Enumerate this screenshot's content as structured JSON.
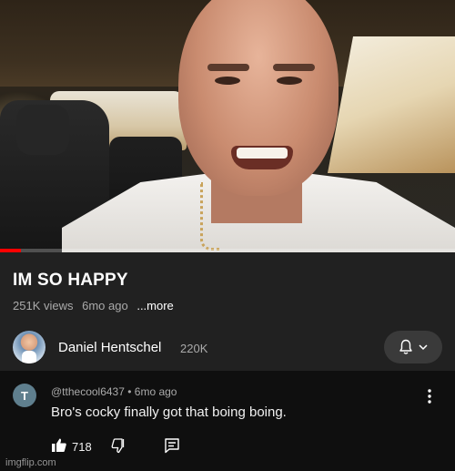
{
  "video": {
    "progress_fraction": 0.046
  },
  "meta": {
    "title": "IM SO HAPPY",
    "views": "251K views",
    "age": "6mo ago",
    "more_label": "...more"
  },
  "channel": {
    "name": "Daniel Hentschel",
    "subscribers": "220K",
    "bell_icon": "bell-icon",
    "chevron_icon": "chevron-down-icon"
  },
  "comment": {
    "avatar_letter": "T",
    "author": "@tthecool6437",
    "age": "6mo ago",
    "header": "@tthecool6437 • 6mo ago",
    "text": "Bro's cocky finally got that boing boing.",
    "like_count": "718"
  },
  "watermark": "imgflip.com",
  "colors": {
    "background": "#0f0f0f",
    "panel": "#212121",
    "progress": "#ff0000",
    "secondary_text": "#aaaaaa",
    "avatar_t": "#5f7f8e"
  }
}
